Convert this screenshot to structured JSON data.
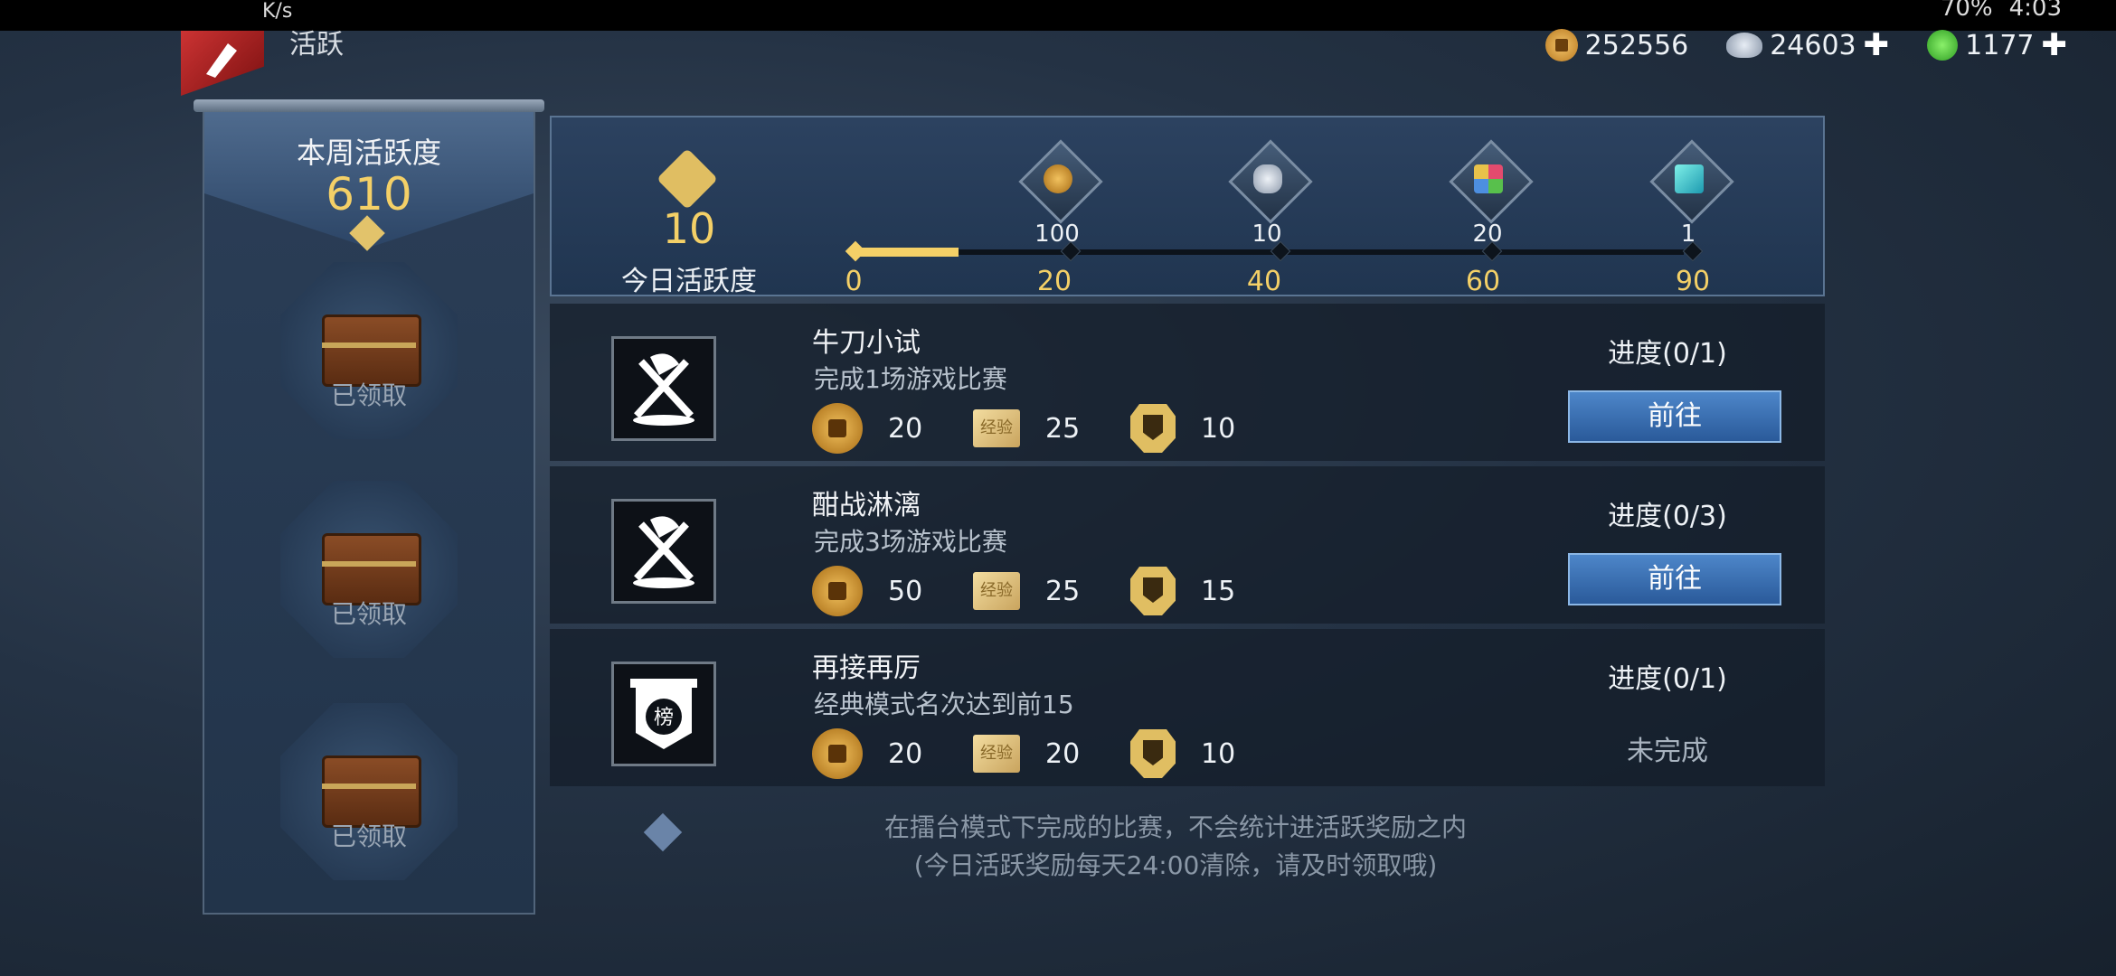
{
  "statusbar": {
    "network_speed": "K/s",
    "battery": "70%",
    "time": "4:03"
  },
  "header": {
    "title": "活跃"
  },
  "currencies": [
    {
      "name": "copper-coin",
      "value": "252556",
      "has_plus": false
    },
    {
      "name": "silver-ingot",
      "value": "24603",
      "has_plus": true
    },
    {
      "name": "jade",
      "value": "1177",
      "has_plus": true
    }
  ],
  "weekly": {
    "title": "本周活跃度",
    "value": "610",
    "chests": [
      {
        "status": "已领取"
      },
      {
        "status": "已领取"
      },
      {
        "status": "已领取"
      }
    ]
  },
  "today": {
    "value": "10",
    "label": "今日活跃度",
    "progress_current": 10,
    "progress_max": 90,
    "milestones": [
      "0",
      "20",
      "40",
      "60",
      "90"
    ],
    "rewards": [
      {
        "icon": "copper-coin-icon",
        "amount": "100"
      },
      {
        "icon": "silver-ingot-icon",
        "amount": "10"
      },
      {
        "icon": "gem-box-icon",
        "amount": "20"
      },
      {
        "icon": "crystal-icon",
        "amount": "1"
      }
    ]
  },
  "tasks": [
    {
      "name": "牛刀小试",
      "desc": "完成1场游戏比赛",
      "rewards": [
        "20",
        "25",
        "10"
      ],
      "progress": "进度(0/1)",
      "action": "前往",
      "completed": false
    },
    {
      "name": "酣战淋漓",
      "desc": "完成3场游戏比赛",
      "rewards": [
        "50",
        "25",
        "15"
      ],
      "progress": "进度(0/3)",
      "action": "前往",
      "completed": false
    },
    {
      "name": "再接再厉",
      "desc": "经典模式名次达到前15",
      "rewards": [
        "20",
        "20",
        "10"
      ],
      "progress": "进度(0/1)",
      "action": "未完成",
      "completed": false
    }
  ],
  "exp_card_text": "经验",
  "notes": {
    "line1": "在擂台模式下完成的比赛，不会统计进活跃奖励之内",
    "line2": "(今日活跃奖励每天24:00清除，请及时领取哦)"
  }
}
